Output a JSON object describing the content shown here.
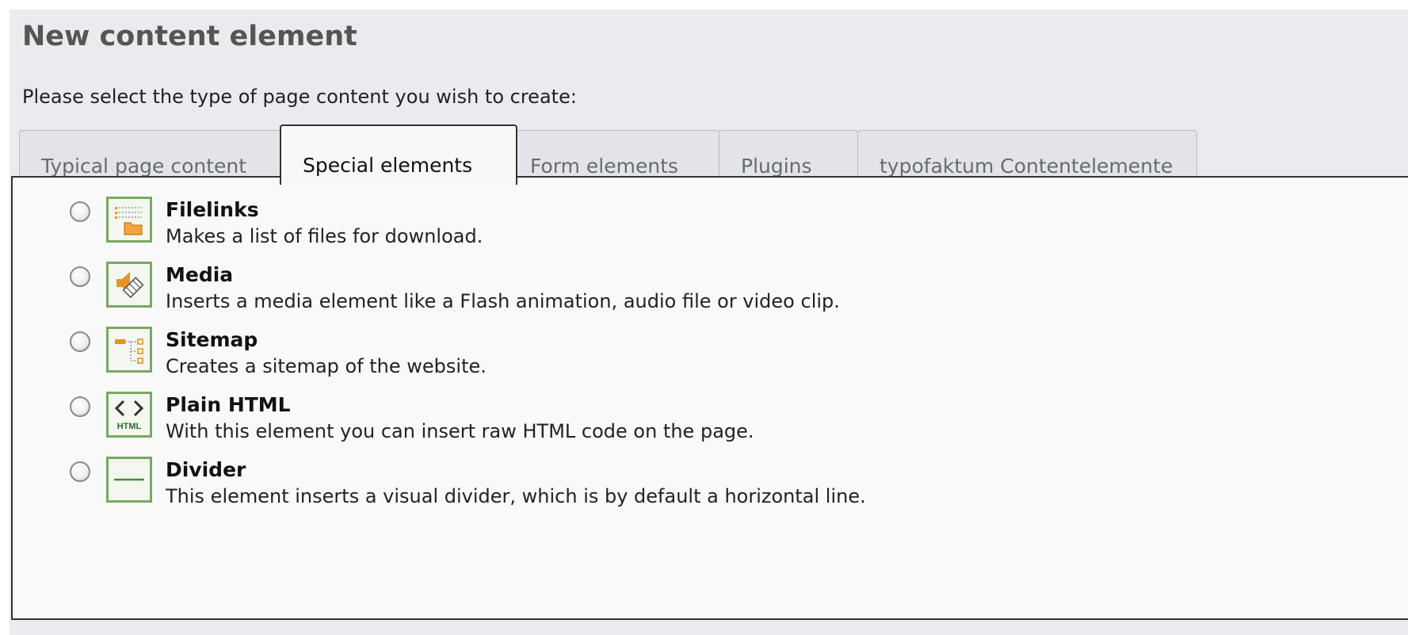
{
  "header": {
    "title": "New content element",
    "subtitle": "Please select the type of page content you wish to create:"
  },
  "tabs": [
    {
      "label": "Typical page content",
      "active": false
    },
    {
      "label": "Special elements",
      "active": true
    },
    {
      "label": "Form elements",
      "active": false
    },
    {
      "label": "Plugins",
      "active": false
    },
    {
      "label": "typofaktum Contentelemente",
      "active": false
    }
  ],
  "items": [
    {
      "label": "Filelinks",
      "description": "Makes a list of files for download.",
      "icon": "filelinks-icon",
      "selected": false
    },
    {
      "label": "Media",
      "description": "Inserts a media element like a Flash animation, audio file or video clip.",
      "icon": "media-icon",
      "selected": false
    },
    {
      "label": "Sitemap",
      "description": "Creates a sitemap of the website.",
      "icon": "sitemap-icon",
      "selected": false
    },
    {
      "label": "Plain HTML",
      "description": "With this element you can insert raw HTML code on the page.",
      "icon": "plain-html-icon",
      "icon_text": "HTML",
      "selected": false
    },
    {
      "label": "Divider",
      "description": "This element inserts a visual divider, which is by default a horizontal line.",
      "icon": "divider-icon",
      "selected": false
    }
  ],
  "colors": {
    "panel_background": "#ebebef",
    "content_background": "#f9f9f9",
    "icon_border": "#79a861",
    "icon_accent": "#e8922a",
    "title_color": "#555555"
  }
}
